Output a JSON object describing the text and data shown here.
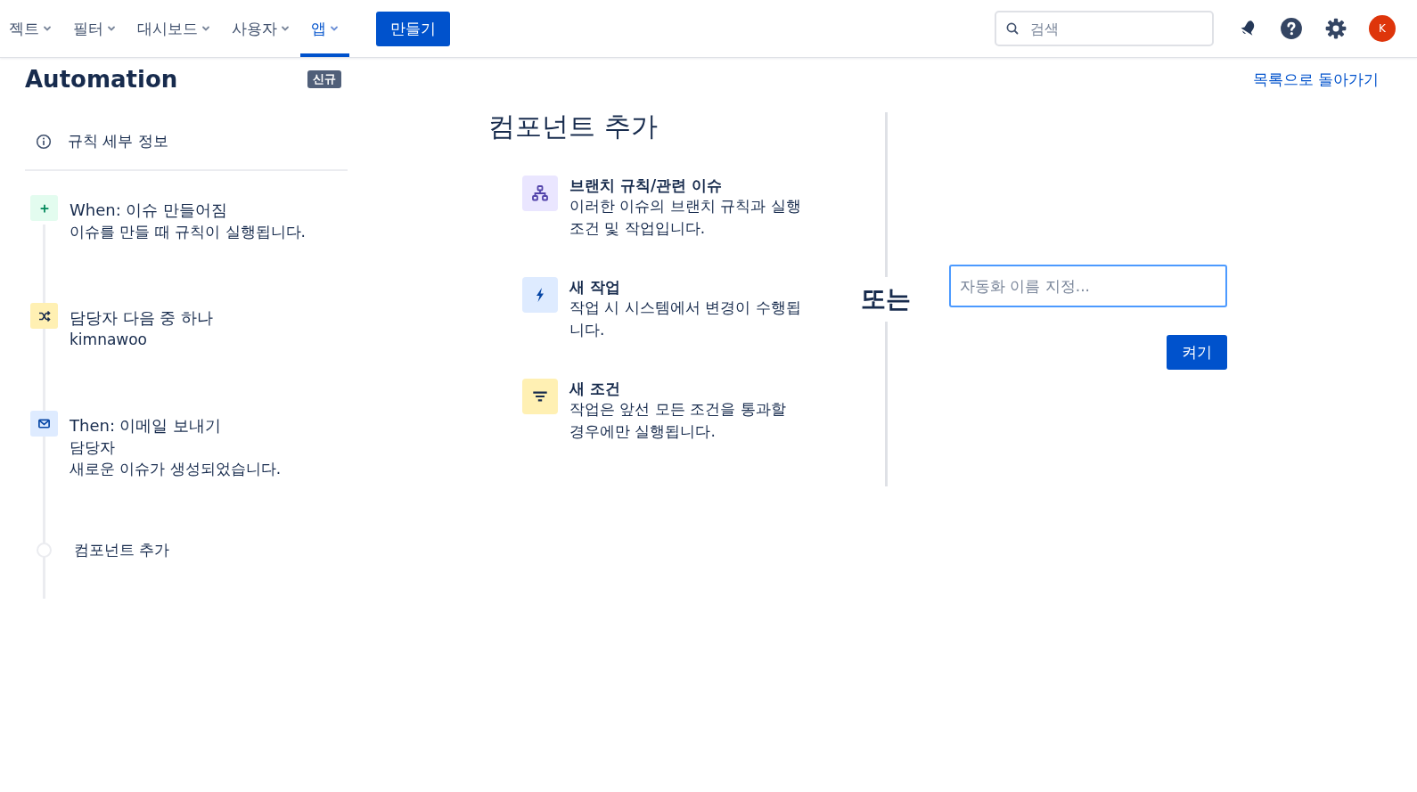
{
  "nav": {
    "items": [
      {
        "label": "젝트",
        "selected": false
      },
      {
        "label": "필터",
        "selected": false
      },
      {
        "label": "대시보드",
        "selected": false
      },
      {
        "label": "사용자",
        "selected": false
      },
      {
        "label": "앱",
        "selected": true
      }
    ],
    "create_button": "만들기",
    "search": {
      "placeholder": "검색"
    },
    "avatar": "K"
  },
  "page": {
    "title": "Automation",
    "badge": "신규",
    "back_link": "목록으로 돌아가기"
  },
  "sidebar": {
    "rule_details": "규칙 세부 정보",
    "steps": [
      {
        "kind": "trigger",
        "label": "When:",
        "title": "이슈 만들어짐",
        "lines": [
          "이슈를 만들 때 규칙이 실행됩니다."
        ]
      },
      {
        "kind": "condition",
        "title": "담당자 다음 중 하나",
        "lines": [
          "kimnawoo"
        ]
      },
      {
        "kind": "action",
        "label": "Then:",
        "title": "이메일 보내기",
        "lines": [
          "담당자",
          "새로운 이슈가 생성되었습니다."
        ]
      }
    ],
    "add_component": "컴포넌트 추가"
  },
  "components": {
    "heading": "컴포넌트 추가",
    "items": [
      {
        "kind": "branch",
        "title": "브랜치 규칙/관련 이슈",
        "description": "이러한 이슈의 브랜치 규칙과 실행 조건 및 작업입니다."
      },
      {
        "kind": "action",
        "title": "새 작업",
        "description": "작업 시 시스템에서 변경이 수행됩니다."
      },
      {
        "kind": "condition",
        "title": "새 조건",
        "description": "작업은 앞선 모든 조건을 통과할 경우에만 실행됩니다."
      }
    ]
  },
  "or_label": "또는",
  "name_form": {
    "placeholder": "자동화 이름 지정...",
    "button": "켜기"
  }
}
